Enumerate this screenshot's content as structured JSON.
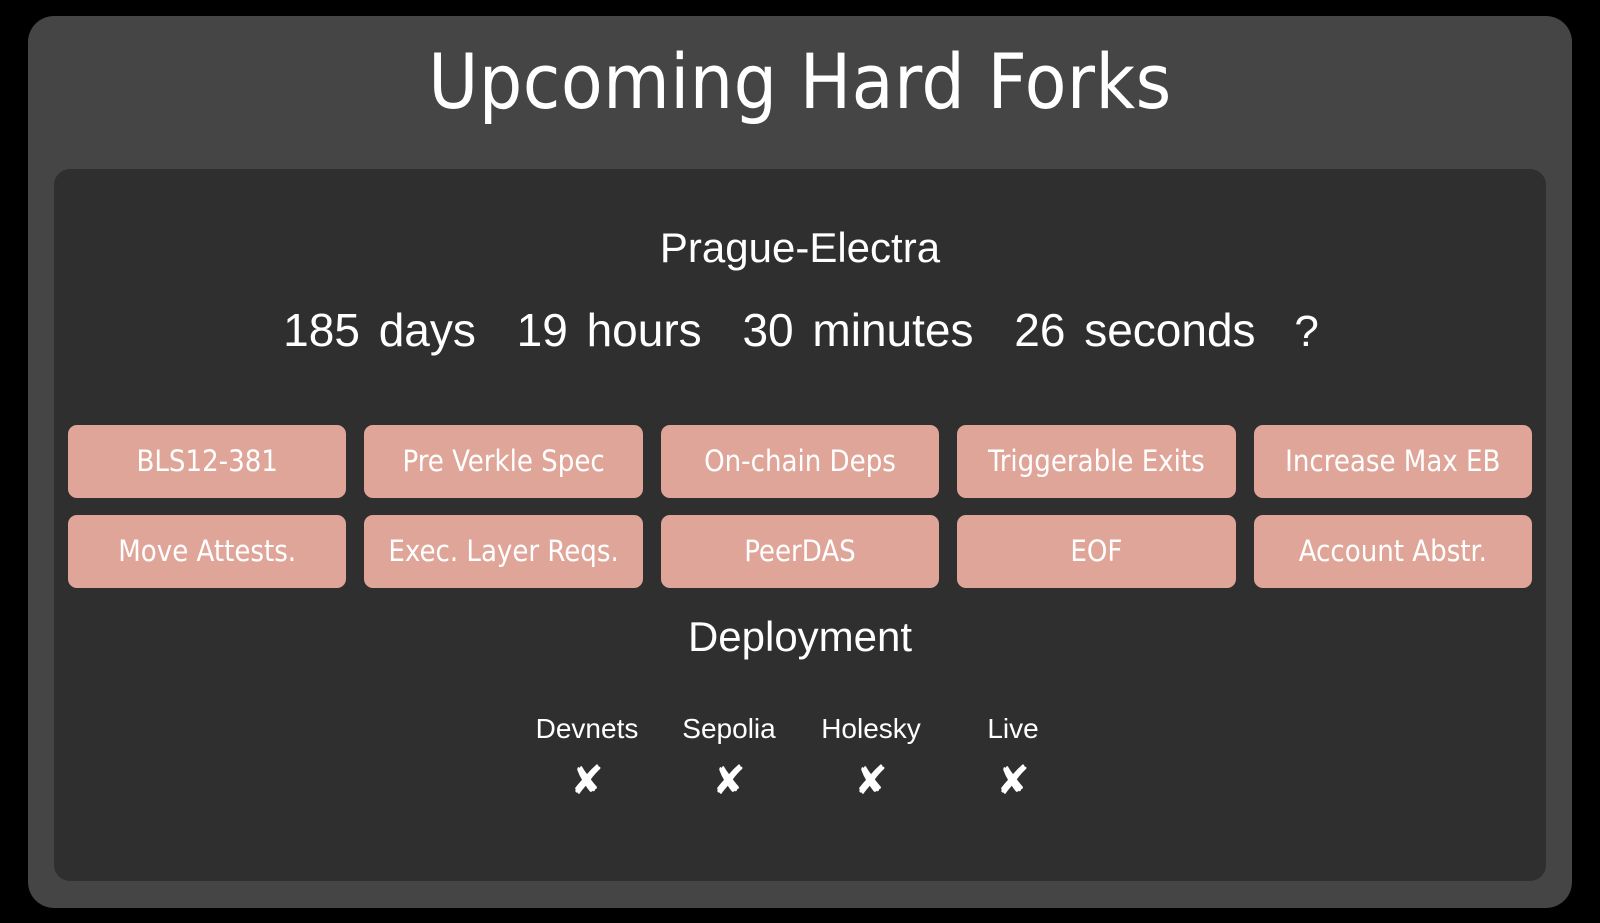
{
  "header": {
    "title": "Upcoming Hard Forks"
  },
  "fork": {
    "name": "Prague-Electra",
    "countdown": {
      "days_value": "185",
      "days_unit": "days",
      "hours_value": "19",
      "hours_unit": "hours",
      "minutes_value": "30",
      "minutes_unit": "minutes",
      "seconds_value": "26",
      "seconds_unit": "seconds",
      "trailing": "?"
    },
    "features": [
      "BLS12-381",
      "Pre Verkle Spec",
      "On-chain Deps",
      "Triggerable Exits",
      "Increase Max EB",
      "Move Attests.",
      "Exec. Layer Reqs.",
      "PeerDAS",
      "EOF",
      "Account Abstr."
    ],
    "deployment": {
      "title": "Deployment",
      "stages": [
        {
          "label": "Devnets",
          "status_icon": "cross-mark",
          "status": "✘"
        },
        {
          "label": "Sepolia",
          "status_icon": "cross-mark",
          "status": "✘"
        },
        {
          "label": "Holesky",
          "status_icon": "cross-mark",
          "status": "✘"
        },
        {
          "label": "Live",
          "status_icon": "cross-mark",
          "status": "✘"
        }
      ]
    }
  },
  "colors": {
    "page_background": "#000000",
    "outer_card": "#454545",
    "inner_card": "#2f2f2f",
    "feature_pill": "#e0a599",
    "text": "#ffffff"
  }
}
